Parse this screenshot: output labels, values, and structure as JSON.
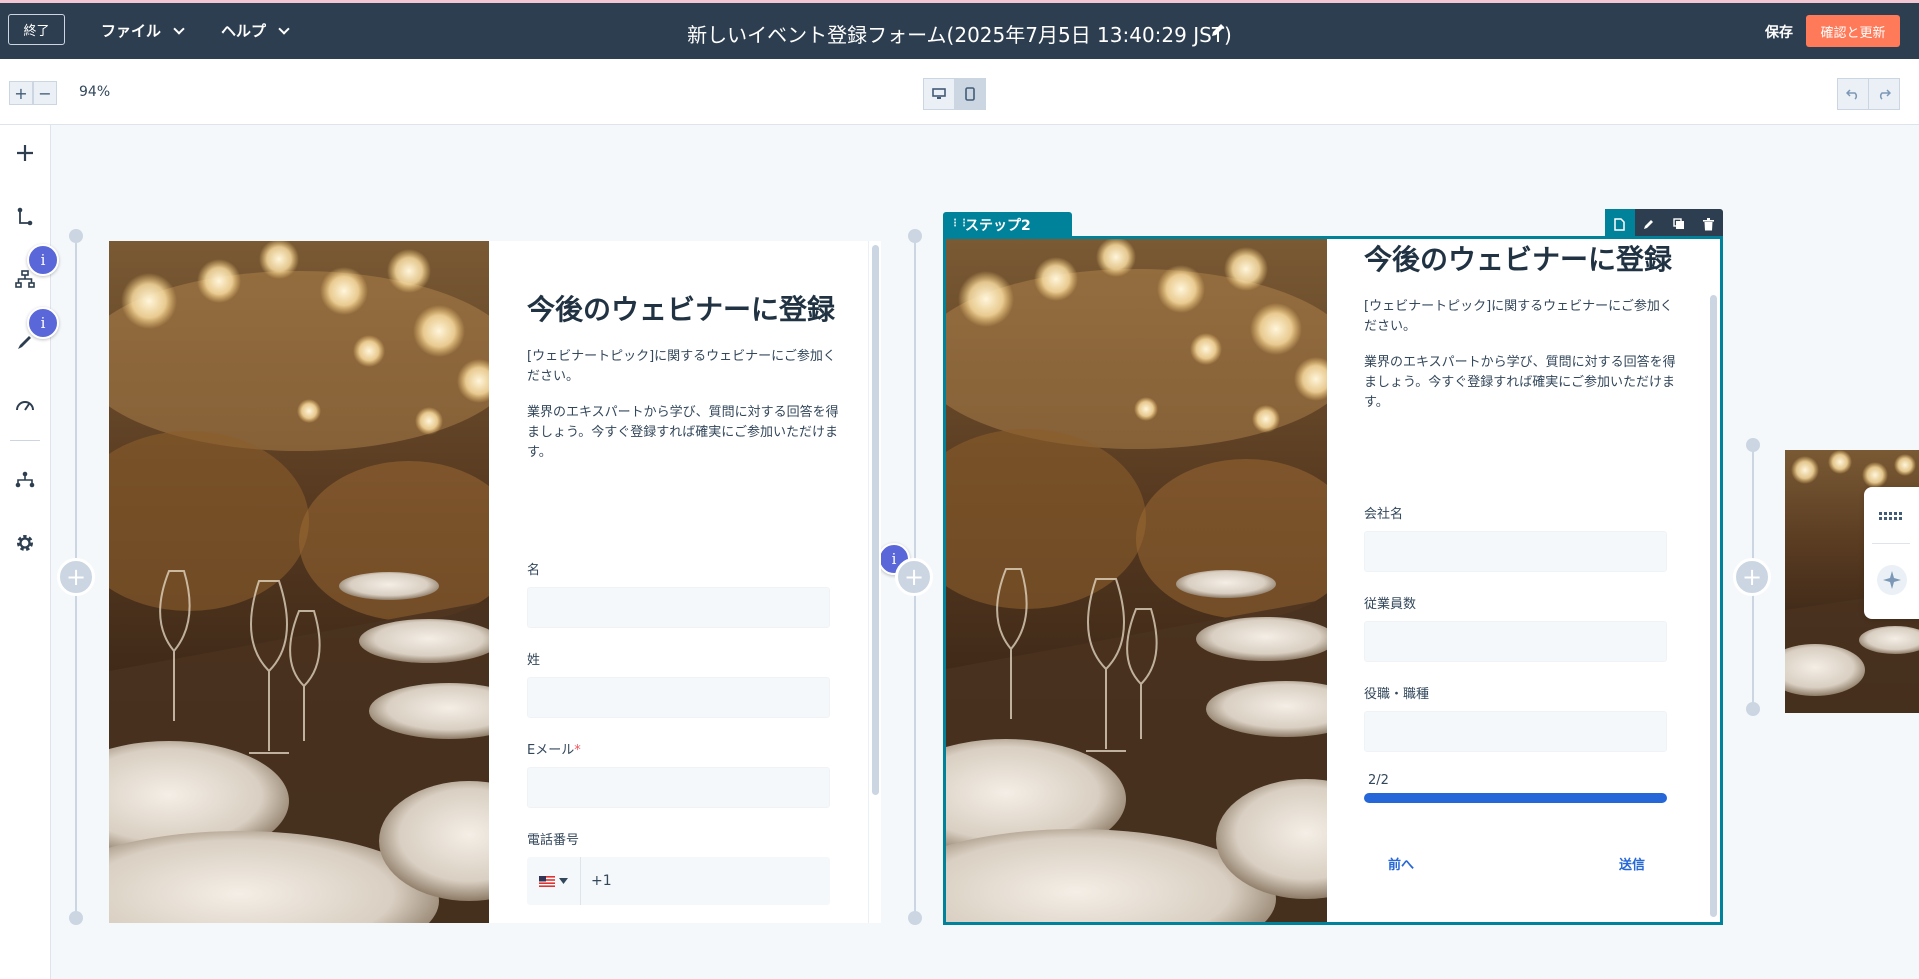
{
  "topbar": {
    "exit_label": "終了",
    "file_menu": "ファイル",
    "help_menu": "ヘルプ",
    "title": "新しいイベント登録フォーム(2025年7月5日 13:40:29 JST)",
    "save_label": "保存",
    "publish_label": "確認と更新"
  },
  "toolbar": {
    "zoom_in": "+",
    "zoom_out": "−",
    "zoom_level": "94%"
  },
  "badge_letter": "i",
  "form": {
    "title": "今後のウェビナーに登録",
    "intro": "[ウェビナートピック]に関するウェビナーにご参加ください。",
    "body": "業界のエキスパートから学び、質問に対する回答を得ましょう。今すぐ登録すれば確実にご参加いただけます。"
  },
  "step1": {
    "fields": [
      "名",
      "姓",
      "Eメール",
      "電話番号"
    ],
    "required_mark": "*",
    "phone_prefix": "+1"
  },
  "step2": {
    "tab_label": "ステップ2",
    "fields": [
      "会社名",
      "従業員数",
      "役職・職種"
    ],
    "progress_text": "2/2",
    "progress": 1.0,
    "prev_label": "前へ",
    "submit_label": "送信"
  },
  "colors": {
    "topbar": "#2d3e50",
    "accent_orange": "#ff7a59",
    "selection_teal": "#00829b",
    "progress_blue": "#2566d8",
    "badge_purple": "#5a67d8"
  }
}
